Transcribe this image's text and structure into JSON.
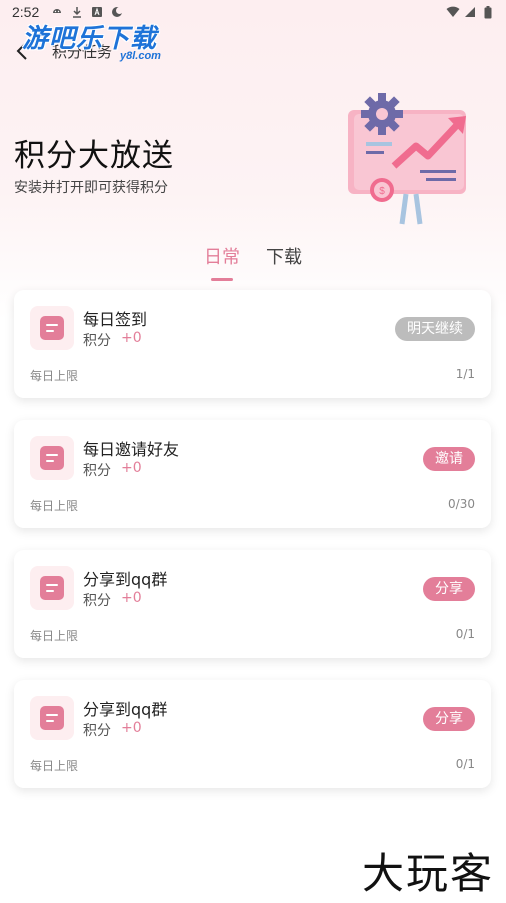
{
  "status_bar": {
    "time": "2:52"
  },
  "nav": {
    "title": "积分任务"
  },
  "watermark": {
    "top": "游吧乐下载",
    "top_sub": "y8l.com",
    "bottom": "大玩客"
  },
  "hero": {
    "title": "积分大放送",
    "subtitle": "安装并打开即可获得积分"
  },
  "tabs": [
    {
      "label": "日常",
      "active": true
    },
    {
      "label": "下载",
      "active": false
    }
  ],
  "tasks": [
    {
      "title": "每日签到",
      "points_label": "积分",
      "points_value": "+0",
      "button": "明天继续",
      "button_state": "disabled",
      "limit_label": "每日上限",
      "limit_value": "1/1"
    },
    {
      "title": "每日邀请好友",
      "points_label": "积分",
      "points_value": "+0",
      "button": "邀请",
      "button_state": "active",
      "limit_label": "每日上限",
      "limit_value": "0/30"
    },
    {
      "title": "分享到qq群",
      "points_label": "积分",
      "points_value": "+0",
      "button": "分享",
      "button_state": "active",
      "limit_label": "每日上限",
      "limit_value": "0/1"
    },
    {
      "title": "分享到qq群",
      "points_label": "积分",
      "points_value": "+0",
      "button": "分享",
      "button_state": "active",
      "limit_label": "每日上限",
      "limit_value": "0/1"
    }
  ],
  "colors": {
    "accent": "#e37e99",
    "disabled": "#bcbcbc",
    "hero_bg": "#fdeef0"
  },
  "icons": {
    "status": [
      "android-icon",
      "download-icon",
      "a-icon",
      "moon-icon",
      "wifi-icon",
      "signal-icon",
      "battery-icon"
    ],
    "nav_back": "back-arrow-icon",
    "task": "document-icon",
    "hero": "chart-board-illustration"
  }
}
